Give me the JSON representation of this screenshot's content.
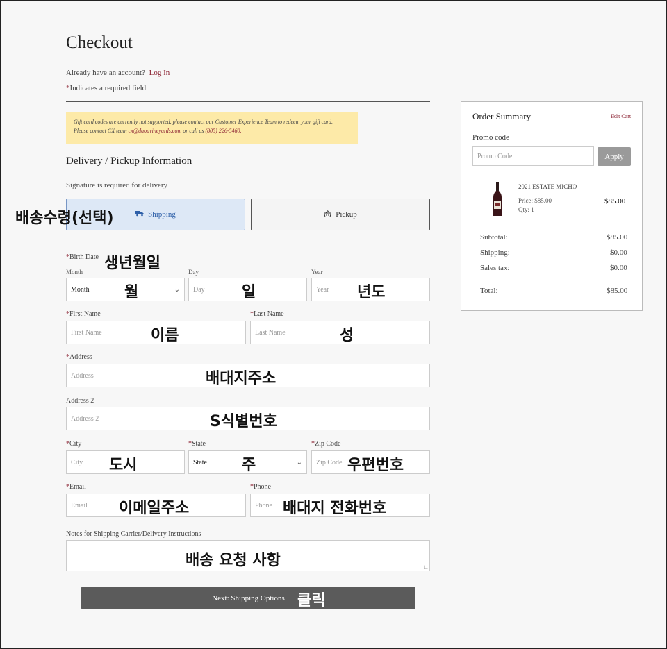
{
  "page": {
    "title": "Checkout"
  },
  "account": {
    "prompt": "Already have an account?",
    "login_link": "Log In",
    "required_note": "Indicates a required field",
    "asterisk": "*"
  },
  "notice": {
    "line1": "Gift card codes are currently not supported, please contact our Customer Experience Team to redeem your gift card.",
    "line2_pre": "Please contact CX team ",
    "email": "cx@daouvineyards.com",
    "line2_mid": " or call us ",
    "phone": "(805) 226-5460."
  },
  "delivery": {
    "heading": "Delivery / Pickup Information",
    "signature_note": "Signature is required for delivery",
    "shipping_label": "Shipping",
    "pickup_label": "Pickup",
    "shipping_annotation": "배송수령(선택)"
  },
  "birth": {
    "label": "Birth Date",
    "annotation": "생년월일",
    "month_label": "Month",
    "month_value": "Month",
    "month_annotation": "월",
    "day_label": "Day",
    "day_placeholder": "Day",
    "day_annotation": "일",
    "year_label": "Year",
    "year_placeholder": "Year",
    "year_annotation": "년도"
  },
  "name": {
    "first_label": "First Name",
    "first_placeholder": "First Name",
    "first_annotation": "이름",
    "last_label": "Last Name",
    "last_placeholder": "Last Name",
    "last_annotation": "성"
  },
  "address": {
    "label": "Address",
    "placeholder": "Address",
    "annotation": "배대지주소",
    "label2": "Address 2",
    "placeholder2": "Address 2",
    "annotation2": "S식별번호"
  },
  "location": {
    "city_label": "City",
    "city_placeholder": "City",
    "city_annotation": "도시",
    "state_label": "State",
    "state_value": "State",
    "state_annotation": "주",
    "zip_label": "Zip Code",
    "zip_placeholder": "Zip Code",
    "zip_annotation": "우편번호"
  },
  "contact": {
    "email_label": "Email",
    "email_placeholder": "Email",
    "email_annotation": "이메일주소",
    "phone_label": "Phone",
    "phone_placeholder": "Phone",
    "phone_annotation": "배대지 전화번호"
  },
  "notes": {
    "label": "Notes for Shipping Carrier/Delivery Instructions",
    "annotation": "배송 요청 사항"
  },
  "next": {
    "label": "Next: Shipping Options",
    "annotation": "클릭"
  },
  "summary": {
    "title": "Order Summary",
    "edit_cart": "Edit Cart",
    "promo_label": "Promo code",
    "promo_placeholder": "Promo Code",
    "apply_label": "Apply",
    "item": {
      "name": "2021 ESTATE MICHO",
      "price": "Price: $85.00",
      "qty": "Qty: 1",
      "total": "$85.00"
    },
    "rows": [
      {
        "label": "Subtotal:",
        "value": "$85.00"
      },
      {
        "label": "Shipping:",
        "value": "$0.00"
      },
      {
        "label": "Sales tax:",
        "value": "$0.00"
      }
    ],
    "total_label": "Total:",
    "total_value": "$85.00"
  },
  "colors": {
    "accent": "#8b2232",
    "selected_bg": "#dde8f6",
    "notice_bg": "#fdeaa8",
    "button": "#5b5b5b"
  }
}
